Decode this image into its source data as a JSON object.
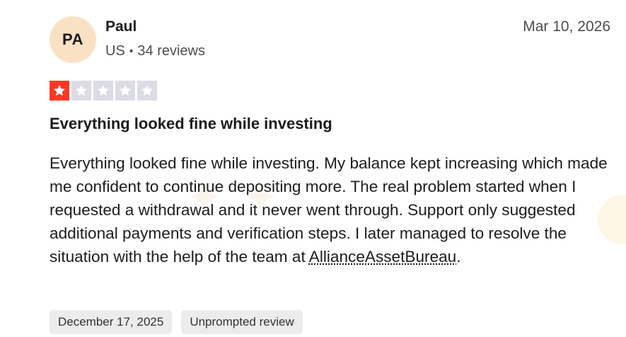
{
  "reviewer": {
    "initials": "PA",
    "name": "Paul",
    "country": "US",
    "separator": "•",
    "review_count": "34 reviews"
  },
  "review": {
    "date": "Mar 10, 2026",
    "rating": 1,
    "rating_max": 5,
    "title": "Everything looked fine while investing",
    "body_text": "Everything looked fine while investing. My balance kept increasing which made me confident to continue depositing more. The real problem started when I requested a withdrawal and it never went through. Support only suggested additional payments and verification steps. I later managed to resolve the situation with the help of the team at ",
    "body_link": "AllianceAssetBureau",
    "body_end": "."
  },
  "tags": {
    "experience_date": "December 17, 2025",
    "review_type": "Unprompted review"
  },
  "colors": {
    "star_filled": "#ff3722",
    "star_empty": "#dcdce6",
    "avatar_bg": "#fbe1c4",
    "tag_bg": "#ececec"
  },
  "icons": {
    "star": "star-icon"
  }
}
